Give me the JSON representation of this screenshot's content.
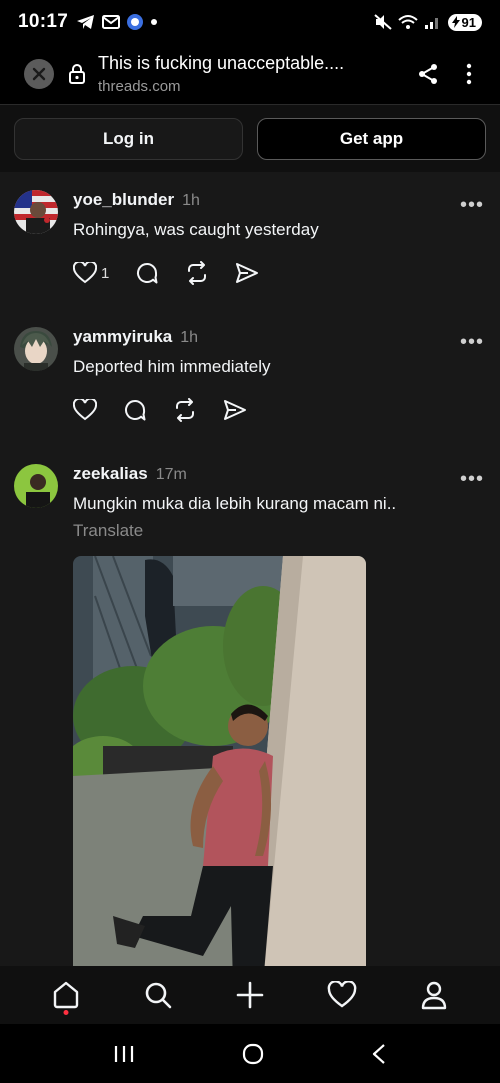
{
  "status_bar": {
    "time": "10:17",
    "battery": "91"
  },
  "browser": {
    "page_title": "This is fucking unacceptable....",
    "domain": "threads.com"
  },
  "auth": {
    "login_label": "Log in",
    "get_app_label": "Get app"
  },
  "posts": [
    {
      "username": "yoe_blunder",
      "time": "1h",
      "text": "Rohingya, was caught yesterday",
      "likes": "1"
    },
    {
      "username": "yammyiruka",
      "time": "1h",
      "text": "Deported him immediately",
      "likes": ""
    },
    {
      "username": "zeekalias",
      "time": "17m",
      "text": "Mungkin muka dia lebih kurang macam ni..",
      "translate": "Translate",
      "likes": ""
    }
  ],
  "icons": {
    "close": "close-icon",
    "lock": "lock-icon",
    "share": "share-icon",
    "more": "more-vertical-icon",
    "like": "heart-icon",
    "reply": "comment-icon",
    "repost": "repost-icon",
    "send": "send-icon",
    "nav_home": "home-icon",
    "nav_search": "search-icon",
    "nav_create": "plus-icon",
    "nav_activity": "heart-icon",
    "nav_profile": "profile-icon"
  },
  "colors": {
    "background": "#181818",
    "text": "#f3f5f7",
    "muted": "#8a8a8a",
    "notification_dot": "#ff3040"
  }
}
